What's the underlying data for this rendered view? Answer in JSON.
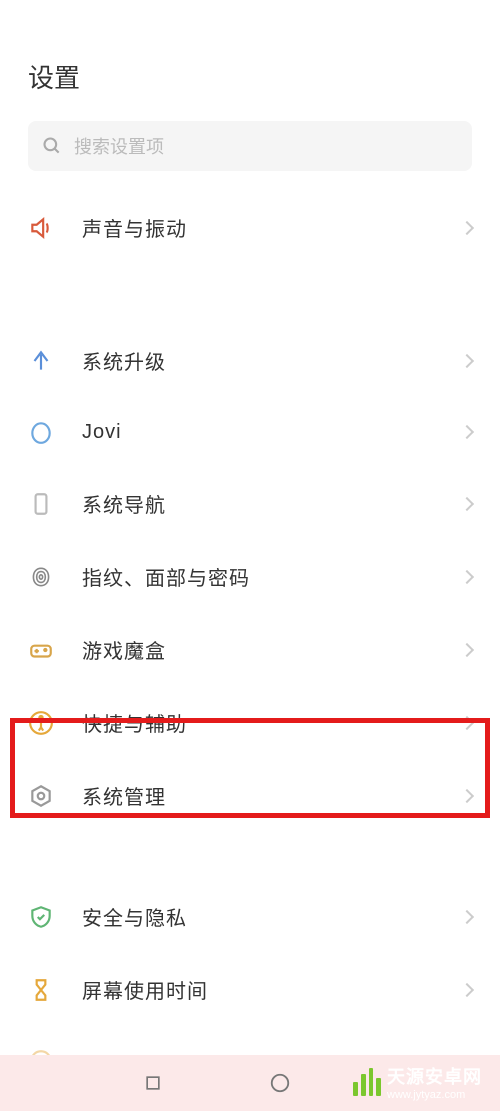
{
  "header": {
    "title": "设置"
  },
  "search": {
    "placeholder": "搜索设置项"
  },
  "items": {
    "sound": {
      "label": "声音与振动",
      "icon": "sound-icon",
      "color": "#d85a3b"
    },
    "upgrade": {
      "label": "系统升级",
      "icon": "arrow-up-icon",
      "color": "#5b8fd9"
    },
    "jovi": {
      "label": "Jovi",
      "icon": "jovi-icon",
      "color": "#6ea8df"
    },
    "nav": {
      "label": "系统导航",
      "icon": "phone-icon",
      "color": "#bbb"
    },
    "biometric": {
      "label": "指纹、面部与密码",
      "icon": "fingerprint-icon",
      "color": "#888"
    },
    "gamebox": {
      "label": "游戏魔盒",
      "icon": "gamepad-icon",
      "color": "#d8a54a"
    },
    "accessibility": {
      "label": "快捷与辅助",
      "icon": "accessibility-icon",
      "color": "#e5a83b"
    },
    "system": {
      "label": "系统管理",
      "icon": "gear-icon",
      "color": "#999"
    },
    "security": {
      "label": "安全与隐私",
      "icon": "shield-icon",
      "color": "#5fb574"
    },
    "screentime": {
      "label": "屏幕使用时间",
      "icon": "hourglass-icon",
      "color": "#e5a83b"
    }
  },
  "watermark": {
    "name": "天源安卓网",
    "url": "www.jytyaz.com"
  }
}
